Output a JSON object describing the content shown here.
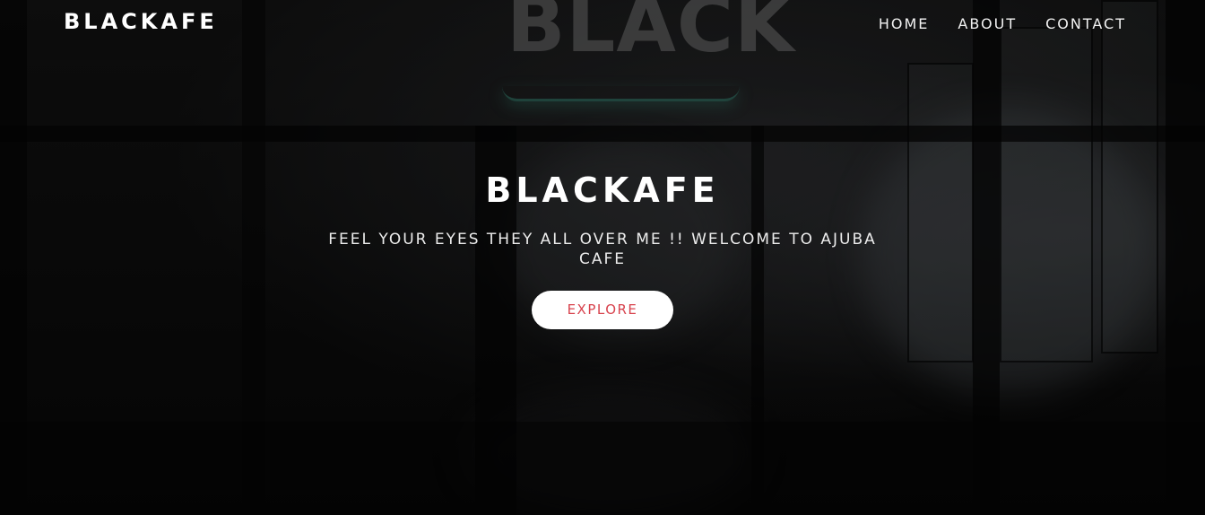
{
  "header": {
    "brand": "BLACKAFE",
    "nav": [
      {
        "label": "HOME"
      },
      {
        "label": "ABOUT"
      },
      {
        "label": "CONTACT"
      }
    ]
  },
  "hero": {
    "title": "BLACKAFE",
    "tagline": "FEEL YOUR EYES THEY ALL OVER ME !! WELCOME TO AJUBA CAFE",
    "cta_label": "EXPLORE"
  },
  "background": {
    "sign_text": "BLACK",
    "description_icon": "cafe-interior-photo"
  },
  "colors": {
    "cta_text": "#d8434e",
    "cta_bg": "#ffffff",
    "text": "#ffffff"
  }
}
